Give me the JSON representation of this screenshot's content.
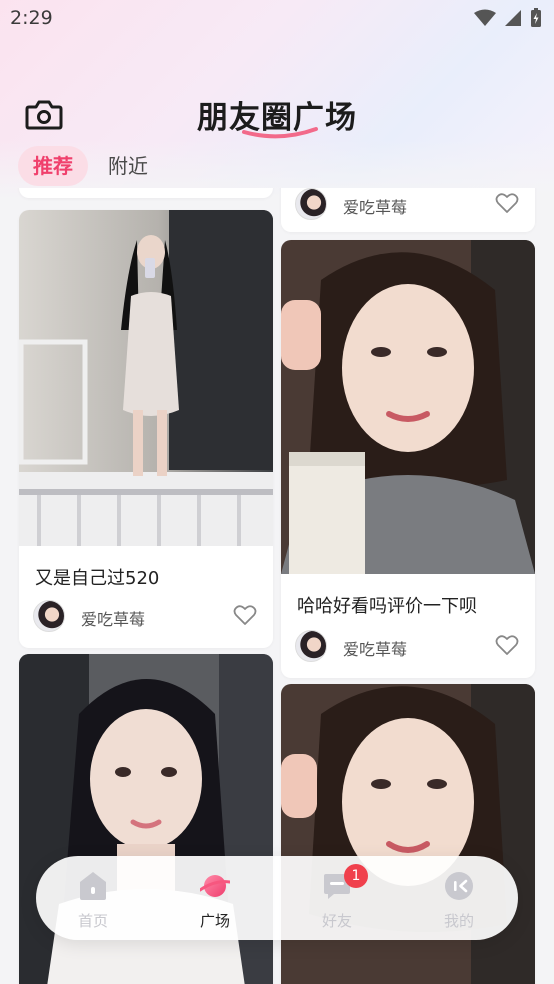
{
  "status_bar": {
    "time": "2:29"
  },
  "header": {
    "title": "朋友圈广场"
  },
  "tabs": [
    {
      "label": "推荐",
      "active": true
    },
    {
      "label": "附近",
      "active": false
    }
  ],
  "feed": {
    "left": [
      {
        "caption": "又是自己过520",
        "author": "爱吃草莓"
      },
      {
        "caption": "",
        "author": ""
      }
    ],
    "right": [
      {
        "caption": "",
        "author": "爱吃草莓"
      },
      {
        "caption": "哈哈好看吗评价一下呗",
        "author": "爱吃草莓"
      },
      {
        "caption": "",
        "author": ""
      }
    ]
  },
  "bottom_nav": {
    "items": [
      {
        "label": "首页",
        "icon": "home-icon",
        "active": false
      },
      {
        "label": "广场",
        "icon": "planet-icon",
        "active": true
      },
      {
        "label": "好友",
        "icon": "chat-icon",
        "active": false,
        "badge": "1"
      },
      {
        "label": "我的",
        "icon": "profile-icon",
        "active": false
      }
    ]
  },
  "colors": {
    "accent": "#f0406c",
    "tab_active_bg": "#fbdde6",
    "badge": "#f0404c"
  }
}
